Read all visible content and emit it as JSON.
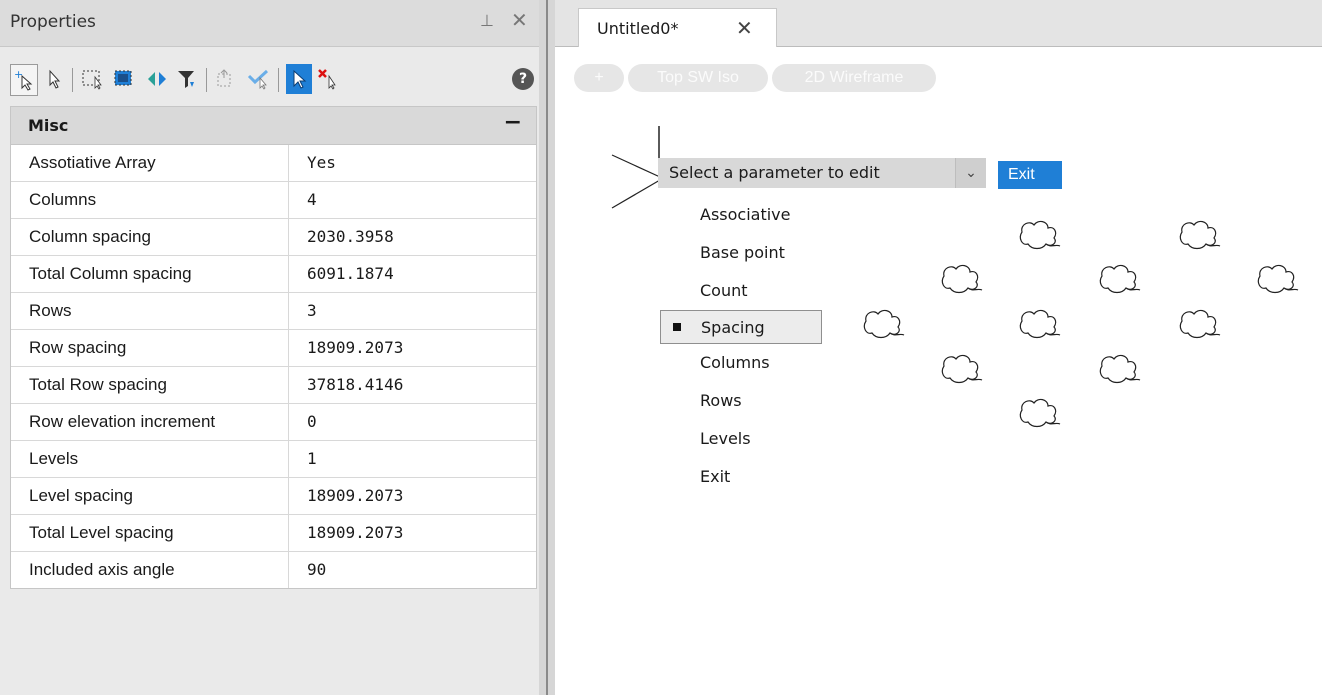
{
  "properties_panel": {
    "title": "Properties",
    "pin_glyph": "⊥",
    "close_glyph": "✕",
    "category": "Misc",
    "collapse_glyph": "−",
    "rows": [
      {
        "key": "Assotiative Array",
        "value": "Yes"
      },
      {
        "key": "Columns",
        "value": "4"
      },
      {
        "key": "Column spacing",
        "value": "2030.3958"
      },
      {
        "key": "Total Column spacing",
        "value": "6091.1874"
      },
      {
        "key": "Rows",
        "value": "3"
      },
      {
        "key": "Row spacing",
        "value": "18909.2073"
      },
      {
        "key": "Total Row spacing",
        "value": "37818.4146"
      },
      {
        "key": "Row elevation increment",
        "value": "0"
      },
      {
        "key": "Levels",
        "value": "1"
      },
      {
        "key": "Level spacing",
        "value": "18909.2073"
      },
      {
        "key": "Total Level spacing",
        "value": "18909.2073"
      },
      {
        "key": "Included axis angle",
        "value": "90"
      }
    ]
  },
  "toolbar": {
    "icons": [
      "add-selection-icon",
      "select-pointer-icon",
      "window-select-icon",
      "quick-select-icon",
      "toggle-select-icon",
      "filter-icon",
      "match-props-icon",
      "check-select-icon",
      "pickadd-icon",
      "deselect-icon",
      "help-icon"
    ],
    "help_glyph": "?"
  },
  "document_tab": {
    "title": "Untitled0*",
    "close_glyph": "✕"
  },
  "view_controls": {
    "plus": "+",
    "view": "Top SW Iso",
    "style": "2D Wireframe"
  },
  "command": {
    "prompt": "Select a parameter to edit",
    "dropdown_glyph": "⌄",
    "exit_button": "Exit",
    "options": [
      "Associative",
      "Base point",
      "Count",
      "Spacing",
      "Columns",
      "Rows",
      "Levels",
      "Exit"
    ],
    "selected": "Spacing"
  },
  "colors": {
    "accent": "#1f7fd6",
    "panel_bg": "#eaeaea",
    "category_bg": "#d9d9d9"
  }
}
